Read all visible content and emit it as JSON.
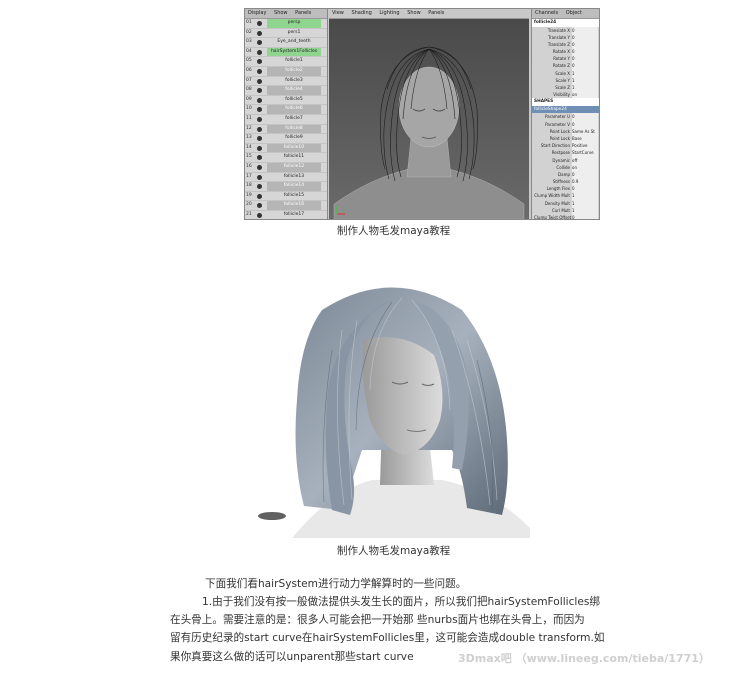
{
  "figure1": {
    "caption": "制作人物毛发maya教程",
    "outliner": {
      "menu": [
        "Display",
        "Show",
        "Panels"
      ],
      "rows": [
        {
          "num": "01",
          "label": "persp",
          "state": "sel"
        },
        {
          "num": "02",
          "label": "pers1",
          "state": "normal"
        },
        {
          "num": "03",
          "label": "Eye_and_teeth",
          "state": "normal"
        },
        {
          "num": "04",
          "label": "hairSystem1Follicles",
          "state": "sel"
        },
        {
          "num": "05",
          "label": "follicle1",
          "state": "normal"
        },
        {
          "num": "06",
          "label": "follicle2",
          "state": "alt"
        },
        {
          "num": "07",
          "label": "follicle3",
          "state": "normal"
        },
        {
          "num": "08",
          "label": "follicle4",
          "state": "alt"
        },
        {
          "num": "09",
          "label": "follicle5",
          "state": "normal"
        },
        {
          "num": "10",
          "label": "follicle6",
          "state": "alt"
        },
        {
          "num": "11",
          "label": "follicle7",
          "state": "normal"
        },
        {
          "num": "12",
          "label": "follicle8",
          "state": "alt"
        },
        {
          "num": "13",
          "label": "follicle9",
          "state": "normal"
        },
        {
          "num": "14",
          "label": "follicle10",
          "state": "alt"
        },
        {
          "num": "15",
          "label": "follicle11",
          "state": "normal"
        },
        {
          "num": "16",
          "label": "follicle12",
          "state": "alt"
        },
        {
          "num": "17",
          "label": "follicle13",
          "state": "normal"
        },
        {
          "num": "18",
          "label": "follicle14",
          "state": "alt"
        },
        {
          "num": "19",
          "label": "follicle15",
          "state": "normal"
        },
        {
          "num": "20",
          "label": "follicle16",
          "state": "alt"
        },
        {
          "num": "21",
          "label": "follicle17",
          "state": "normal"
        },
        {
          "num": "22",
          "label": "follicle18",
          "state": "alt"
        },
        {
          "num": "23",
          "label": "follicle19",
          "state": "normal"
        },
        {
          "num": "24",
          "label": "follicle20",
          "state": "alt"
        },
        {
          "num": "25",
          "label": "follicle21",
          "state": "normal"
        },
        {
          "num": "26",
          "label": "follicle22",
          "state": "alt"
        },
        {
          "num": "27",
          "label": "follicle23",
          "state": "normal"
        }
      ]
    },
    "viewport": {
      "menu": [
        "View",
        "Shading",
        "Lighting",
        "Show",
        "Panels"
      ]
    },
    "channel_box": {
      "tabs": [
        "Channels",
        "Object"
      ],
      "node": "follicle24",
      "transform": [
        {
          "k": "Translate X",
          "v": "0"
        },
        {
          "k": "Translate Y",
          "v": "0"
        },
        {
          "k": "Translate Z",
          "v": "0"
        },
        {
          "k": "Rotate X",
          "v": "0"
        },
        {
          "k": "Rotate Y",
          "v": "0"
        },
        {
          "k": "Rotate Z",
          "v": "0"
        },
        {
          "k": "Scale X",
          "v": "1"
        },
        {
          "k": "Scale Y",
          "v": "1"
        },
        {
          "k": "Scale Z",
          "v": "1"
        },
        {
          "k": "Visibility",
          "v": "on"
        }
      ],
      "shapes_label": "SHAPES",
      "shape_node": "follicleShape24",
      "shape_attrs": [
        {
          "k": "Parameter U",
          "v": "0"
        },
        {
          "k": "Parameter V",
          "v": "0"
        },
        {
          "k": "Point Lock",
          "v": "Same As St"
        },
        {
          "k": "Point Lock",
          "v": "Base"
        },
        {
          "k": "Start Direction",
          "v": "Positive"
        },
        {
          "k": "Restpose",
          "v": "StartCurve"
        },
        {
          "k": "Dynamic",
          "v": "off"
        },
        {
          "k": "Collide",
          "v": "on"
        },
        {
          "k": "Damp",
          "v": "0"
        },
        {
          "k": "Stiffness",
          "v": "0.9"
        },
        {
          "k": "Length Flex",
          "v": "0"
        },
        {
          "k": "Clump Width Mult",
          "v": "1"
        },
        {
          "k": "Density Mult",
          "v": "1"
        },
        {
          "k": "Curl Mult",
          "v": "1"
        },
        {
          "k": "Clump Twist Offset",
          "v": "0"
        },
        {
          "k": "Braid",
          "v": "off"
        },
        {
          "k": "Color Blend",
          "v": "0"
        },
        {
          "k": "Color R",
          "v": "0"
        },
        {
          "k": "Color G",
          "v": "0"
        },
        {
          "k": "Color B",
          "v": "0"
        }
      ]
    }
  },
  "figure2": {
    "caption": "制作人物毛发maya教程"
  },
  "text": {
    "line1": "下面我们看hairSystem进行动力学解算时的一些问题。",
    "line2": "1.由于我们没有按一般做法提供头发生长的面片，所以我们把hairSystemFollicles绑",
    "line3": "在头骨上。需要注意的是：很多人可能会把一开始那 些nurbs面片也绑在头骨上，而因为",
    "line4": "留有历史纪录的start curve在hairSystemFollicles里，这可能会造成double transform.如",
    "line5": "果你真要这么做的话可以unparent那些start curve"
  },
  "watermark": "3Dmax吧 （www.lineeg.com/tieba/1771）"
}
